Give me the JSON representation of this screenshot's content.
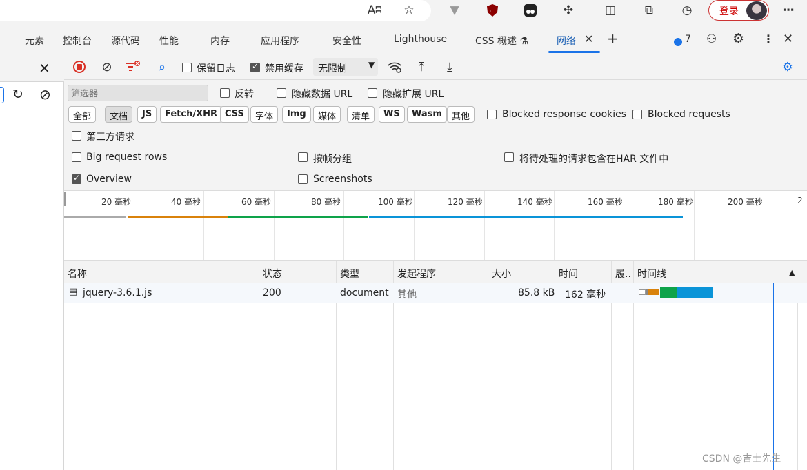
{
  "browser": {
    "read_aloud_glyph": "Aʭ",
    "login_label": "登录"
  },
  "tabs": [
    {
      "label": "元素"
    },
    {
      "label": "控制台"
    },
    {
      "label": "源代码"
    },
    {
      "label": "性能"
    },
    {
      "label": "内存"
    },
    {
      "label": "应用程序"
    },
    {
      "label": "安全性"
    },
    {
      "label": "Lighthouse"
    },
    {
      "label": "CSS 概述 ⚗"
    },
    {
      "label": "网络"
    }
  ],
  "tabs_right": {
    "issues_count": "7"
  },
  "toolbar": {
    "preserve_log_label": "保留日志",
    "disable_cache_label": "禁用缓存",
    "throttle_value": "无限制"
  },
  "filters": {
    "placeholder": "筛选器",
    "invert_label": "反转",
    "hide_data_url_label": "隐藏数据 URL",
    "hide_ext_url_label": "隐藏扩展 URL",
    "chips": [
      "全部",
      "文档",
      "JS",
      "Fetch/XHR",
      "CSS",
      "字体",
      "Img",
      "媒体",
      "清单",
      "WS",
      "Wasm",
      "其他"
    ],
    "selected_chip": "文档",
    "blocked_cookies_label": "Blocked response cookies",
    "blocked_requests_label": "Blocked requests",
    "third_party_label": "第三方请求"
  },
  "options": {
    "big_rows_label": "Big request rows",
    "group_by_frame_label": "按帧分组",
    "har_label": "将待处理的请求包含在HAR 文件中",
    "overview_label": "Overview",
    "screenshots_label": "Screenshots"
  },
  "overview_ticks": [
    "20 毫秒",
    "40 毫秒",
    "60 毫秒",
    "80 毫秒",
    "100 毫秒",
    "120 毫秒",
    "140 毫秒",
    "160 毫秒",
    "180 毫秒",
    "200 毫秒",
    "2"
  ],
  "table": {
    "headers": [
      "名称",
      "状态",
      "类型",
      "发起程序",
      "大小",
      "时间",
      "履..",
      "时间线"
    ],
    "rows": [
      {
        "name": "jquery-3.6.1.js",
        "status": "200",
        "type": "document",
        "initiator": "其他",
        "size": "85.8 kB",
        "time": "162 毫秒",
        "fulfilled": ""
      }
    ]
  },
  "watermark": "CSDN @吉士先生",
  "colors": {
    "accent": "#1a73e8",
    "record_red": "#d93025",
    "waiting_green": "#0ea34a",
    "download_blue": "#0a94d8",
    "queue_orange": "#d9820b"
  }
}
